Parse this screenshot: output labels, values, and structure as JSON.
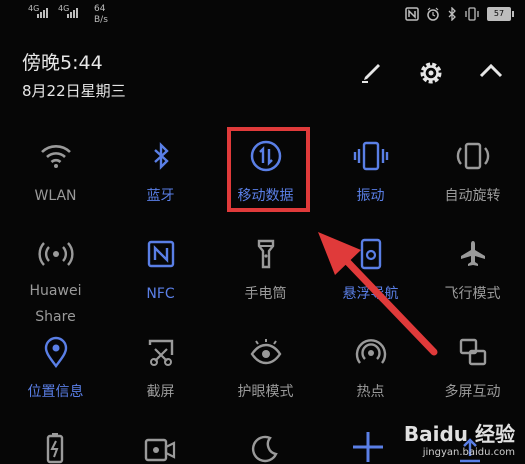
{
  "status_bar": {
    "sig1_label": "4G",
    "sig2_label": "4G",
    "speed_value": "64",
    "speed_unit": "B/s",
    "battery": "57"
  },
  "header": {
    "time": "傍晚5:44",
    "date": "8月22日星期三"
  },
  "tiles": [
    {
      "label": "WLAN",
      "icon": "wifi-icon",
      "active": false
    },
    {
      "label": "蓝牙",
      "icon": "bluetooth-icon",
      "active": true
    },
    {
      "label": "移动数据",
      "icon": "mobile-data-icon",
      "active": true
    },
    {
      "label": "振动",
      "icon": "vibrate-icon",
      "active": true
    },
    {
      "label": "自动旋转",
      "icon": "auto-rotate-icon",
      "active": false
    },
    {
      "label": "Huawei\nShare",
      "icon": "huawei-share-icon",
      "active": false
    },
    {
      "label": "NFC",
      "icon": "nfc-icon",
      "active": true
    },
    {
      "label": "手电筒",
      "icon": "flashlight-icon",
      "active": false
    },
    {
      "label": "悬浮导航",
      "icon": "floating-nav-icon",
      "active": true
    },
    {
      "label": "飞行模式",
      "icon": "airplane-icon",
      "active": false
    },
    {
      "label": "位置信息",
      "icon": "location-icon",
      "active": true
    },
    {
      "label": "截屏",
      "icon": "screenshot-icon",
      "active": false
    },
    {
      "label": "护眼模式",
      "icon": "eye-comfort-icon",
      "active": false
    },
    {
      "label": "热点",
      "icon": "hotspot-icon",
      "active": false
    },
    {
      "label": "多屏互动",
      "icon": "multi-screen-icon",
      "active": false
    }
  ],
  "watermark": {
    "brand": "Baidu 经验",
    "url": "jingyan.baidu.com"
  },
  "colors": {
    "accent": "#5a7fe6",
    "inactive": "#9a9a9a",
    "highlight": "#e03a3a"
  }
}
